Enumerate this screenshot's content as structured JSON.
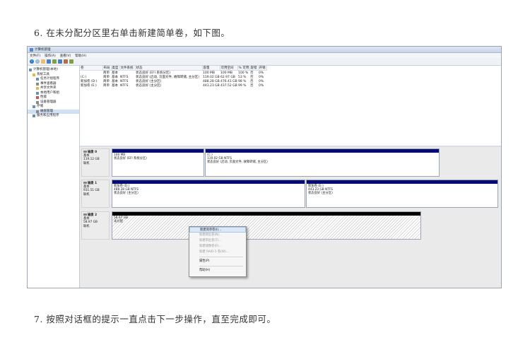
{
  "captions": {
    "step6": "6. 在未分配分区里右单击新建简单卷，如下图。",
    "step7": "7. 按照对话框的提示一直点击下一步操作，直至完成即可。"
  },
  "window": {
    "title": "计算机管理",
    "menu": [
      "文件(F)",
      "操作(A)",
      "查看(V)",
      "帮助(H)"
    ]
  },
  "nav": {
    "items": [
      {
        "label": "计算机管理(本地)",
        "indent": 0
      },
      {
        "label": "系统工具",
        "indent": 1
      },
      {
        "label": "任务计划程序",
        "indent": 2
      },
      {
        "label": "事件查看器",
        "indent": 2
      },
      {
        "label": "共享文件夹",
        "indent": 2
      },
      {
        "label": "本地用户和组",
        "indent": 2
      },
      {
        "label": "性能",
        "indent": 2
      },
      {
        "label": "设备管理器",
        "indent": 2
      },
      {
        "label": "存储",
        "indent": 1
      },
      {
        "label": "磁盘管理",
        "indent": 2
      },
      {
        "label": "服务和应用程序",
        "indent": 1
      }
    ]
  },
  "volume_list": {
    "headers": [
      "卷",
      "布局",
      "类型",
      "文件系统",
      "状态",
      "容量",
      "可用空间",
      "% 可用",
      "容错",
      "开销"
    ],
    "rows": [
      [
        "",
        "简单",
        "基本",
        "",
        "状态良好 (EFI 系统分区)",
        "100 MB",
        "100 MB",
        "100 %",
        "否",
        "0%"
      ],
      [
        "(C:)",
        "简单",
        "基本",
        "NTFS",
        "状态良好 (启动, 页面文件, 故障转储, 主分区)",
        "119.02 GB",
        "62.97 GB",
        "53 %",
        "否",
        "0%"
      ],
      [
        "新加卷 (D:)",
        "简单",
        "基本",
        "NTFS",
        "状态良好 (主分区)",
        "488.28 GB",
        "476.41 GB",
        "98 %",
        "否",
        "0%"
      ],
      [
        "新加卷 (E:)",
        "简单",
        "基本",
        "NTFS",
        "状态良好 (主分区)",
        "443.23 GB",
        "437.52 GB",
        "99 %",
        "否",
        "0%"
      ]
    ]
  },
  "disks": [
    {
      "name": "磁盘 0",
      "type": "基本",
      "size": "119.12 GB",
      "status": "联机"
    },
    {
      "name": "磁盘 1",
      "type": "基本",
      "size": "931.51 GB",
      "status": "联机"
    },
    {
      "name": "磁盘 2",
      "type": "基本",
      "size": "58.97 GB",
      "status": "联机"
    }
  ],
  "partitions": {
    "d0p1": {
      "name": "",
      "size": "100 MB",
      "status": "状态良好 (EFI 系统分区)"
    },
    "d0p2": {
      "name": "(C:)",
      "size": "119.02 GB NTFS",
      "status": "状态良好 (启动, 页面文件, 故障转储, 主分区)"
    },
    "d1p1": {
      "name": "新加卷 (D:)",
      "size": "488.28 GB NTFS",
      "status": "状态良好 (主分区)"
    },
    "d1p2": {
      "name": "新加卷 (E:)",
      "size": "443.23 GB NTFS",
      "status": "状态良好 (主分区)"
    },
    "d2p1": {
      "name": "",
      "size": "58.97 GB",
      "status": "未分配"
    }
  },
  "context_menu": {
    "items": [
      {
        "label": "新建简单卷(I)...",
        "state": "highlighted"
      },
      {
        "label": "新建跨区卷(N)...",
        "state": "disabled"
      },
      {
        "label": "新建带区卷(T)...",
        "state": "disabled"
      },
      {
        "label": "新建镜像卷(R)...",
        "state": "disabled"
      },
      {
        "label": "新建 RAID-5 卷(W)...",
        "state": "disabled"
      },
      {
        "label": "属性(P)",
        "state": "normal"
      },
      {
        "label": "帮助(H)",
        "state": "normal"
      }
    ]
  },
  "colors": {
    "primary_partition_bar": "#050a74",
    "unallocated_bar": "#000000",
    "highlight": "#dbe8f8"
  }
}
